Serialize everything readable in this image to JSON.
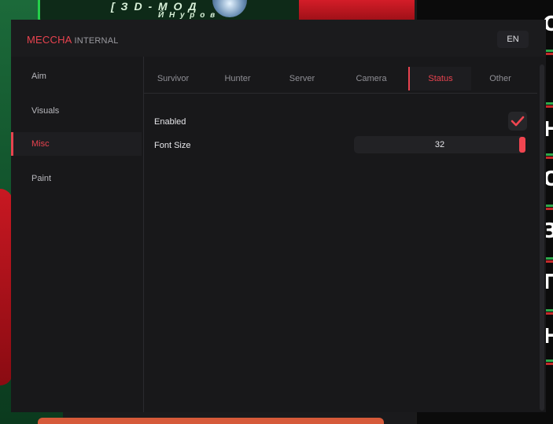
{
  "background": {
    "banner_text": "[ З D - М О Д",
    "banner_subtext": "Й Н  у р о в",
    "right_letters": [
      "О",
      "Н",
      "О",
      "З",
      "Г",
      "Н"
    ],
    "right_top_letter": "К"
  },
  "app": {
    "brand_primary": "MECCHA",
    "brand_secondary": "INTERNAL",
    "language": "EN",
    "accent_color": "#e8434f"
  },
  "sidebar": {
    "items": [
      {
        "label": "Aim",
        "active": false
      },
      {
        "label": "Visuals",
        "active": false
      },
      {
        "label": "Misc",
        "active": true
      },
      {
        "label": "Paint",
        "active": false
      }
    ]
  },
  "tabs": [
    {
      "label": "Survivor",
      "active": false
    },
    {
      "label": "Hunter",
      "active": false
    },
    {
      "label": "Server",
      "active": false
    },
    {
      "label": "Camera",
      "active": false
    },
    {
      "label": "Status",
      "active": true
    },
    {
      "label": "Other",
      "active": false
    }
  ],
  "settings": {
    "enabled_label": "Enabled",
    "enabled_checked": true,
    "font_size_label": "Font Size",
    "font_size_value": "32",
    "check_icon": "checkmark-icon"
  }
}
